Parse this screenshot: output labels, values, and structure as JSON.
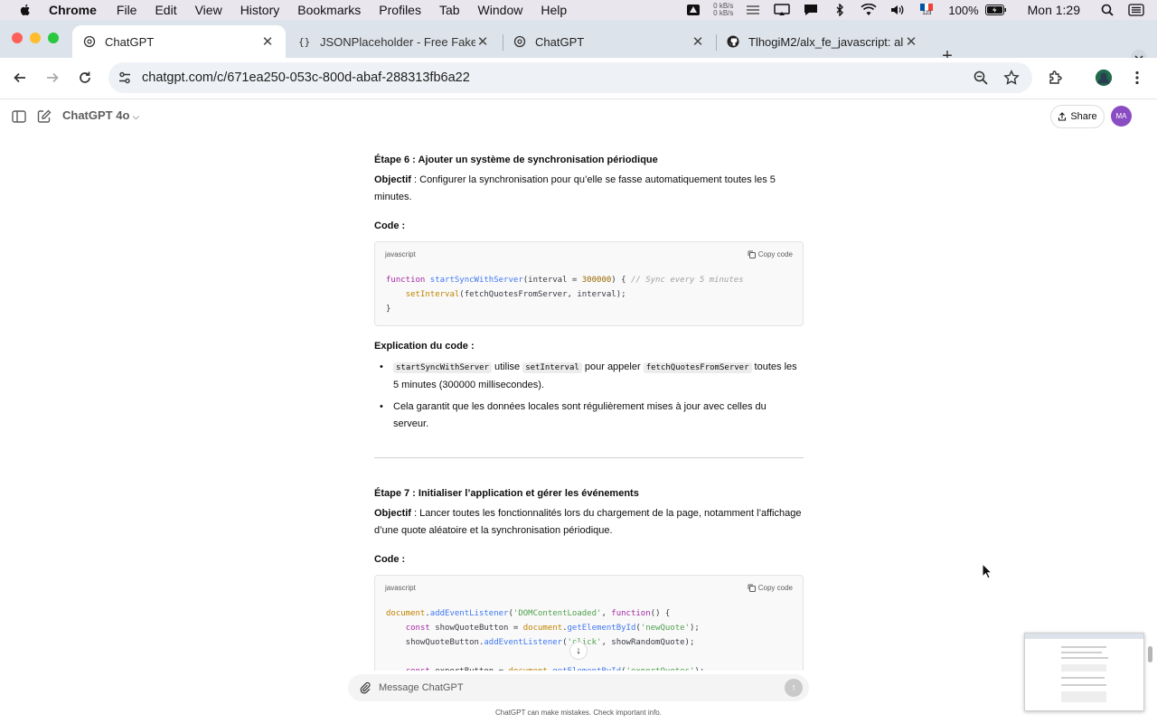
{
  "menubar": {
    "app": "Chrome",
    "items": [
      "File",
      "Edit",
      "View",
      "History",
      "Bookmarks",
      "Profiles",
      "Tab",
      "Window",
      "Help"
    ],
    "net_up": "0 kB/s",
    "net_down": "0 kB/s",
    "keyboard_layout": "123",
    "battery": "100%",
    "clock": "Mon 1:29"
  },
  "tabs": [
    {
      "title": "ChatGPT",
      "icon": "openai-icon"
    },
    {
      "title": "JSONPlaceholder - Free Fake",
      "icon": "json-icon"
    },
    {
      "title": "ChatGPT",
      "icon": "openai-icon"
    },
    {
      "title": "TlhogiM2/alx_fe_javascript: al",
      "icon": "github-icon"
    }
  ],
  "omnibox": {
    "url": "chatgpt.com/c/671ea250-053c-800d-abaf-288313fb6a22"
  },
  "chat_header": {
    "model": "ChatGPT 4o",
    "share": "Share",
    "avatar": "MA"
  },
  "step6": {
    "title": "Étape 6 : Ajouter un système de synchronisation périodique",
    "objective_label": "Objectif",
    "objective_text": " : Configurer la synchronisation pour qu’elle se fasse automatiquement toutes les 5 minutes.",
    "code_label": "Code :",
    "code_lang": "javascript",
    "copy": "Copy code",
    "explain_label": "Explication du code :",
    "bullet1_code1": "startSyncWithServer",
    "bullet1_t1": " utilise ",
    "bullet1_code2": "setInterval",
    "bullet1_t2": " pour appeler ",
    "bullet1_code3": "fetchQuotesFromServer",
    "bullet1_t3": " toutes les 5 minutes (300000 millisecondes).",
    "bullet2": "Cela garantit que les données locales sont régulièrement mises à jour avec celles du serveur."
  },
  "step7": {
    "title": "Étape 7 : Initialiser l’application et gérer les événements",
    "objective_label": "Objectif",
    "objective_text": " : Lancer toutes les fonctionnalités lors du chargement de la page, notamment l’affichage d’une quote aléatoire et la synchronisation périodique.",
    "code_label": "Code :",
    "code_lang": "javascript",
    "copy": "Copy code"
  },
  "composer": {
    "placeholder": "Message ChatGPT",
    "disclaimer": "ChatGPT can make mistakes. Check important info."
  }
}
